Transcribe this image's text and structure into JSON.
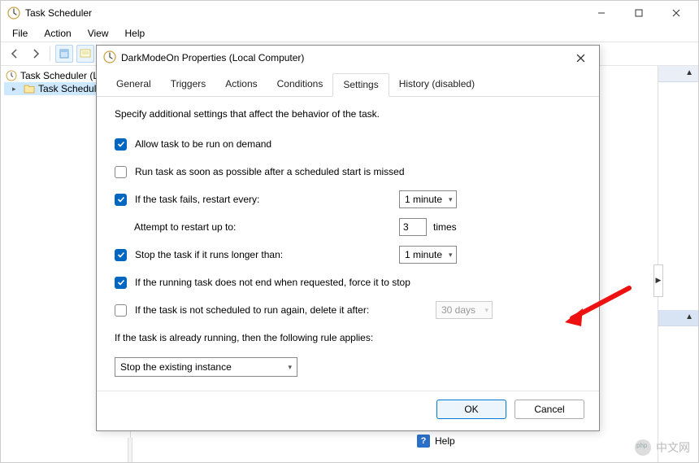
{
  "main_window": {
    "title": "Task Scheduler",
    "menu": {
      "file": "File",
      "action": "Action",
      "view": "View",
      "help": "Help"
    },
    "tree": {
      "root": "Task Scheduler (L",
      "child": "Task Schedul"
    },
    "bottom_help": "Help"
  },
  "dialog": {
    "title": "DarkModeOn Properties (Local Computer)",
    "tabs": {
      "general": "General",
      "triggers": "Triggers",
      "actions": "Actions",
      "conditions": "Conditions",
      "settings": "Settings",
      "history": "History (disabled)"
    },
    "description": "Specify additional settings that affect the behavior of the task.",
    "settings": {
      "allow_demand": {
        "label": "Allow task to be run on demand",
        "checked": true
      },
      "run_asap": {
        "label": "Run task as soon as possible after a scheduled start is missed",
        "checked": false
      },
      "restart_fail": {
        "label": "If the task fails, restart every:",
        "checked": true,
        "value": "1 minute"
      },
      "restart_attempts": {
        "label": "Attempt to restart up to:",
        "value": "3",
        "suffix": "times"
      },
      "stop_longer": {
        "label": "Stop the task if it runs longer than:",
        "checked": true,
        "value": "1 minute"
      },
      "force_stop": {
        "label": "If the running task does not end when requested, force it to stop",
        "checked": true
      },
      "delete_after": {
        "label": "If the task is not scheduled to run again, delete it after:",
        "checked": false,
        "value": "30 days"
      },
      "already_running_label": "If the task is already running, then the following rule applies:",
      "rule_value": "Stop the existing instance"
    },
    "buttons": {
      "ok": "OK",
      "cancel": "Cancel"
    }
  },
  "watermark": "中文网"
}
